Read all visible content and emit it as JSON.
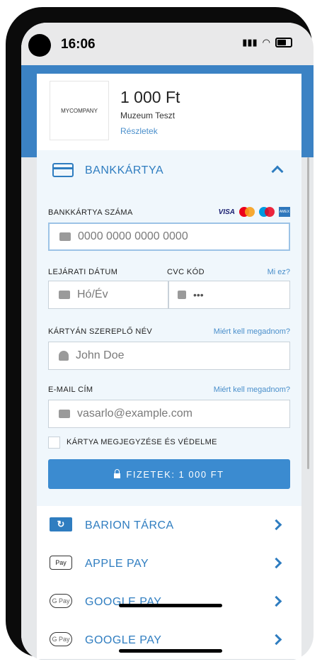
{
  "status_bar": {
    "time": "16:06"
  },
  "merchant": {
    "logo_text": "MYCOMPANY",
    "amount": "1 000 Ft",
    "name": "Muzeum Teszt",
    "details_link": "Részletek"
  },
  "card_section": {
    "title": "BANKKÁRTYA",
    "card_number_label": "BANKKÁRTYA SZÁMA",
    "card_number_placeholder": "0000 0000 0000 0000",
    "brands": [
      "VISA",
      "Mastercard",
      "Maestro",
      "AMEX"
    ],
    "expiry_label": "LEJÁRATI DÁTUM",
    "expiry_placeholder": "Hó/Év",
    "cvc_label": "CVC KÓD",
    "cvc_help": "Mi ez?",
    "cvc_placeholder": "•••",
    "name_label": "KÁRTYÁN SZEREPLŐ NÉV",
    "name_help": "Miért kell megadnom?",
    "name_placeholder": "John Doe",
    "email_label": "E-MAIL CÍM",
    "email_help": "Miért kell megadnom?",
    "email_placeholder": "vasarlo@example.com",
    "remember_label": "KÁRTYA MEGJEGYZÉSE ÉS VÉDELME",
    "pay_button": "FIZETEK: 1 000 FT"
  },
  "methods": [
    {
      "label": "BARION TÁRCA",
      "icon": "barion-icon"
    },
    {
      "label": "APPLE PAY",
      "icon": "apple-pay-icon",
      "badge": "Pay"
    },
    {
      "label": "GOOGLE PAY",
      "icon": "google-pay-icon",
      "badge": "G Pay"
    },
    {
      "label": "GOOGLE PAY",
      "icon": "google-pay-icon",
      "badge": "G Pay"
    }
  ],
  "colors": {
    "accent": "#2f7dc0",
    "header_blue": "#3b82c4",
    "pay_button": "#3b8bd0"
  }
}
